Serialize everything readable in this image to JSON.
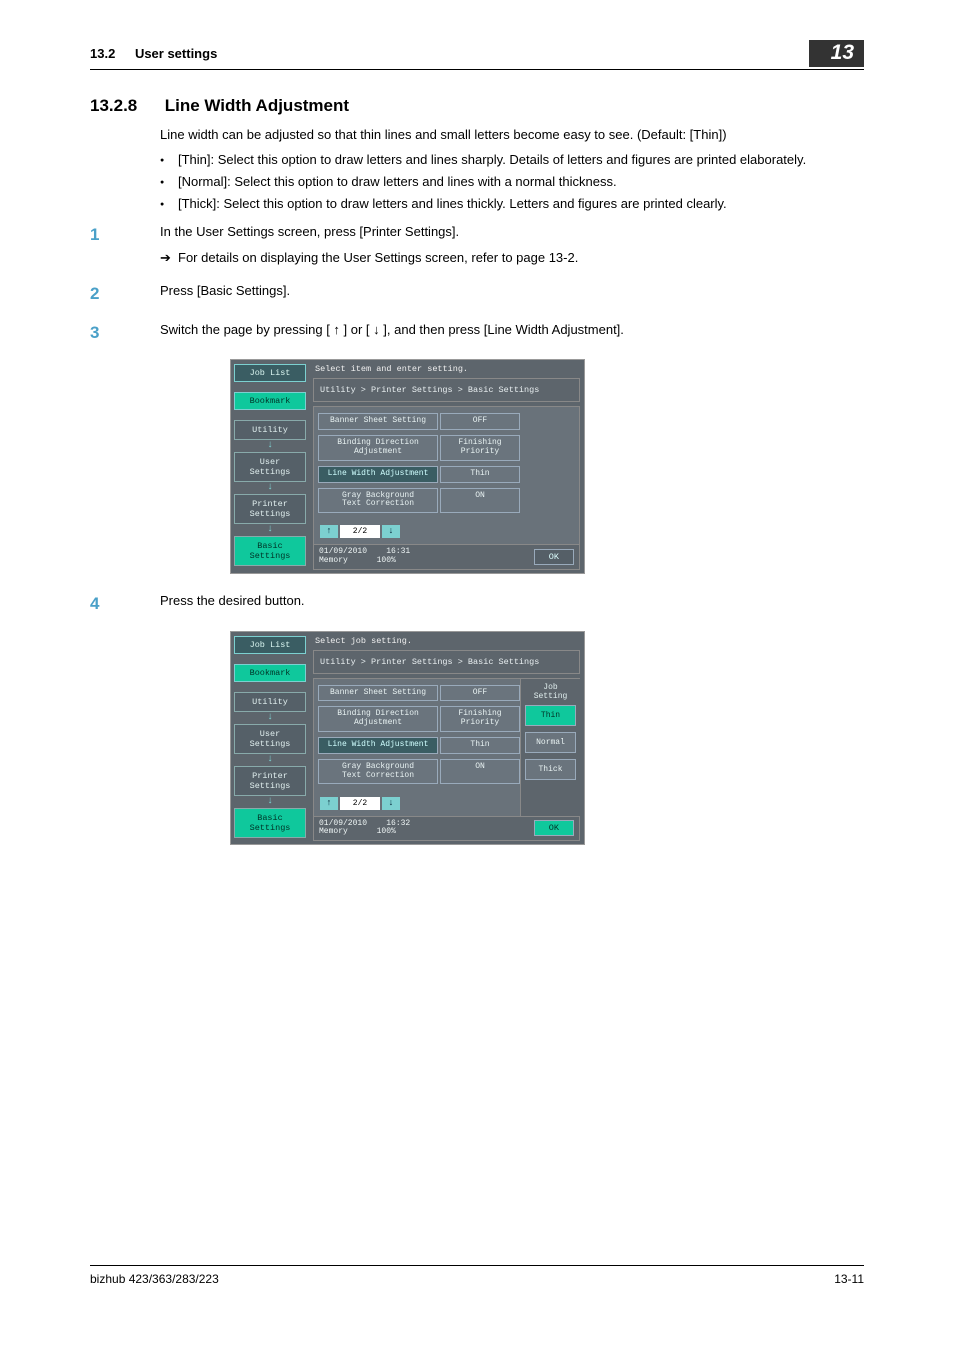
{
  "header": {
    "section": "13.2",
    "title": "User settings",
    "chapter": "13"
  },
  "section": {
    "number": "13.2.8",
    "title": "Line Width Adjustment",
    "intro": "Line width can be adjusted so that thin lines and small letters become easy to see. (Default: [Thin])",
    "bullets": [
      "[Thin]: Select this option to draw letters and lines sharply. Details of letters and figures are printed elaborately.",
      "[Normal]: Select this option to draw letters and lines with a normal thickness.",
      "[Thick]: Select this option to draw letters and lines thickly. Letters and figures are printed clearly."
    ]
  },
  "steps": {
    "s1": {
      "text": "In the User Settings screen, press [Printer Settings].",
      "sub": "For details on displaying the User Settings screen, refer to page 13-2."
    },
    "s2": {
      "text": "Press [Basic Settings]."
    },
    "s3": {
      "text": "Switch the page by pressing [ ↑ ] or [ ↓ ], and then press [Line Width Adjustment]."
    },
    "s4": {
      "text": "Press the desired button."
    }
  },
  "screen1": {
    "top_instruction": "Select item and enter setting.",
    "left_tabs": {
      "job_list": "Job List",
      "bookmark": "Bookmark"
    },
    "nav": {
      "utility": "Utility",
      "user_settings": "User Settings",
      "printer_settings": "Printer Settings",
      "basic_settings": "Basic Settings"
    },
    "breadcrumb": "Utility > Printer Settings > Basic Settings",
    "rows": {
      "banner_label": "Banner Sheet Setting",
      "banner_val": "OFF",
      "binding_label": "Binding Direction Adjustment",
      "binding_val": "Finishing Priority",
      "linewidth_label": "Line Width Adjustment",
      "linewidth_val": "Thin",
      "gray_label": "Gray Background\nText Correction",
      "gray_val": "ON"
    },
    "pager": {
      "up": "↑",
      "text": "2/2",
      "down": "↓"
    },
    "status": {
      "date": "01/09/2010",
      "time": "16:31",
      "mem_label": "Memory",
      "mem_val": "100%"
    },
    "ok": "OK"
  },
  "screen2": {
    "top_instruction": "Select job setting.",
    "left_tabs": {
      "job_list": "Job List",
      "bookmark": "Bookmark"
    },
    "nav": {
      "utility": "Utility",
      "user_settings": "User Settings",
      "printer_settings": "Printer Settings",
      "basic_settings": "Basic Settings"
    },
    "breadcrumb": "Utility > Printer Settings > Basic Settings",
    "rows": {
      "banner_label": "Banner Sheet Setting",
      "banner_val": "OFF",
      "binding_label": "Binding Direction Adjustment",
      "binding_val": "Finishing Priority",
      "linewidth_label": "Line Width Adjustment",
      "linewidth_val": "Thin",
      "gray_label": "Gray Background\nText Correction",
      "gray_val": "ON"
    },
    "options": {
      "title": "Job Setting",
      "thin": "Thin",
      "normal": "Normal",
      "thick": "Thick"
    },
    "pager": {
      "up": "↑",
      "text": "2/2",
      "down": "↓"
    },
    "status": {
      "date": "01/09/2010",
      "time": "16:32",
      "mem_label": "Memory",
      "mem_val": "100%"
    },
    "ok": "OK"
  },
  "footer": {
    "left": "bizhub 423/363/283/223",
    "right": "13-11"
  }
}
